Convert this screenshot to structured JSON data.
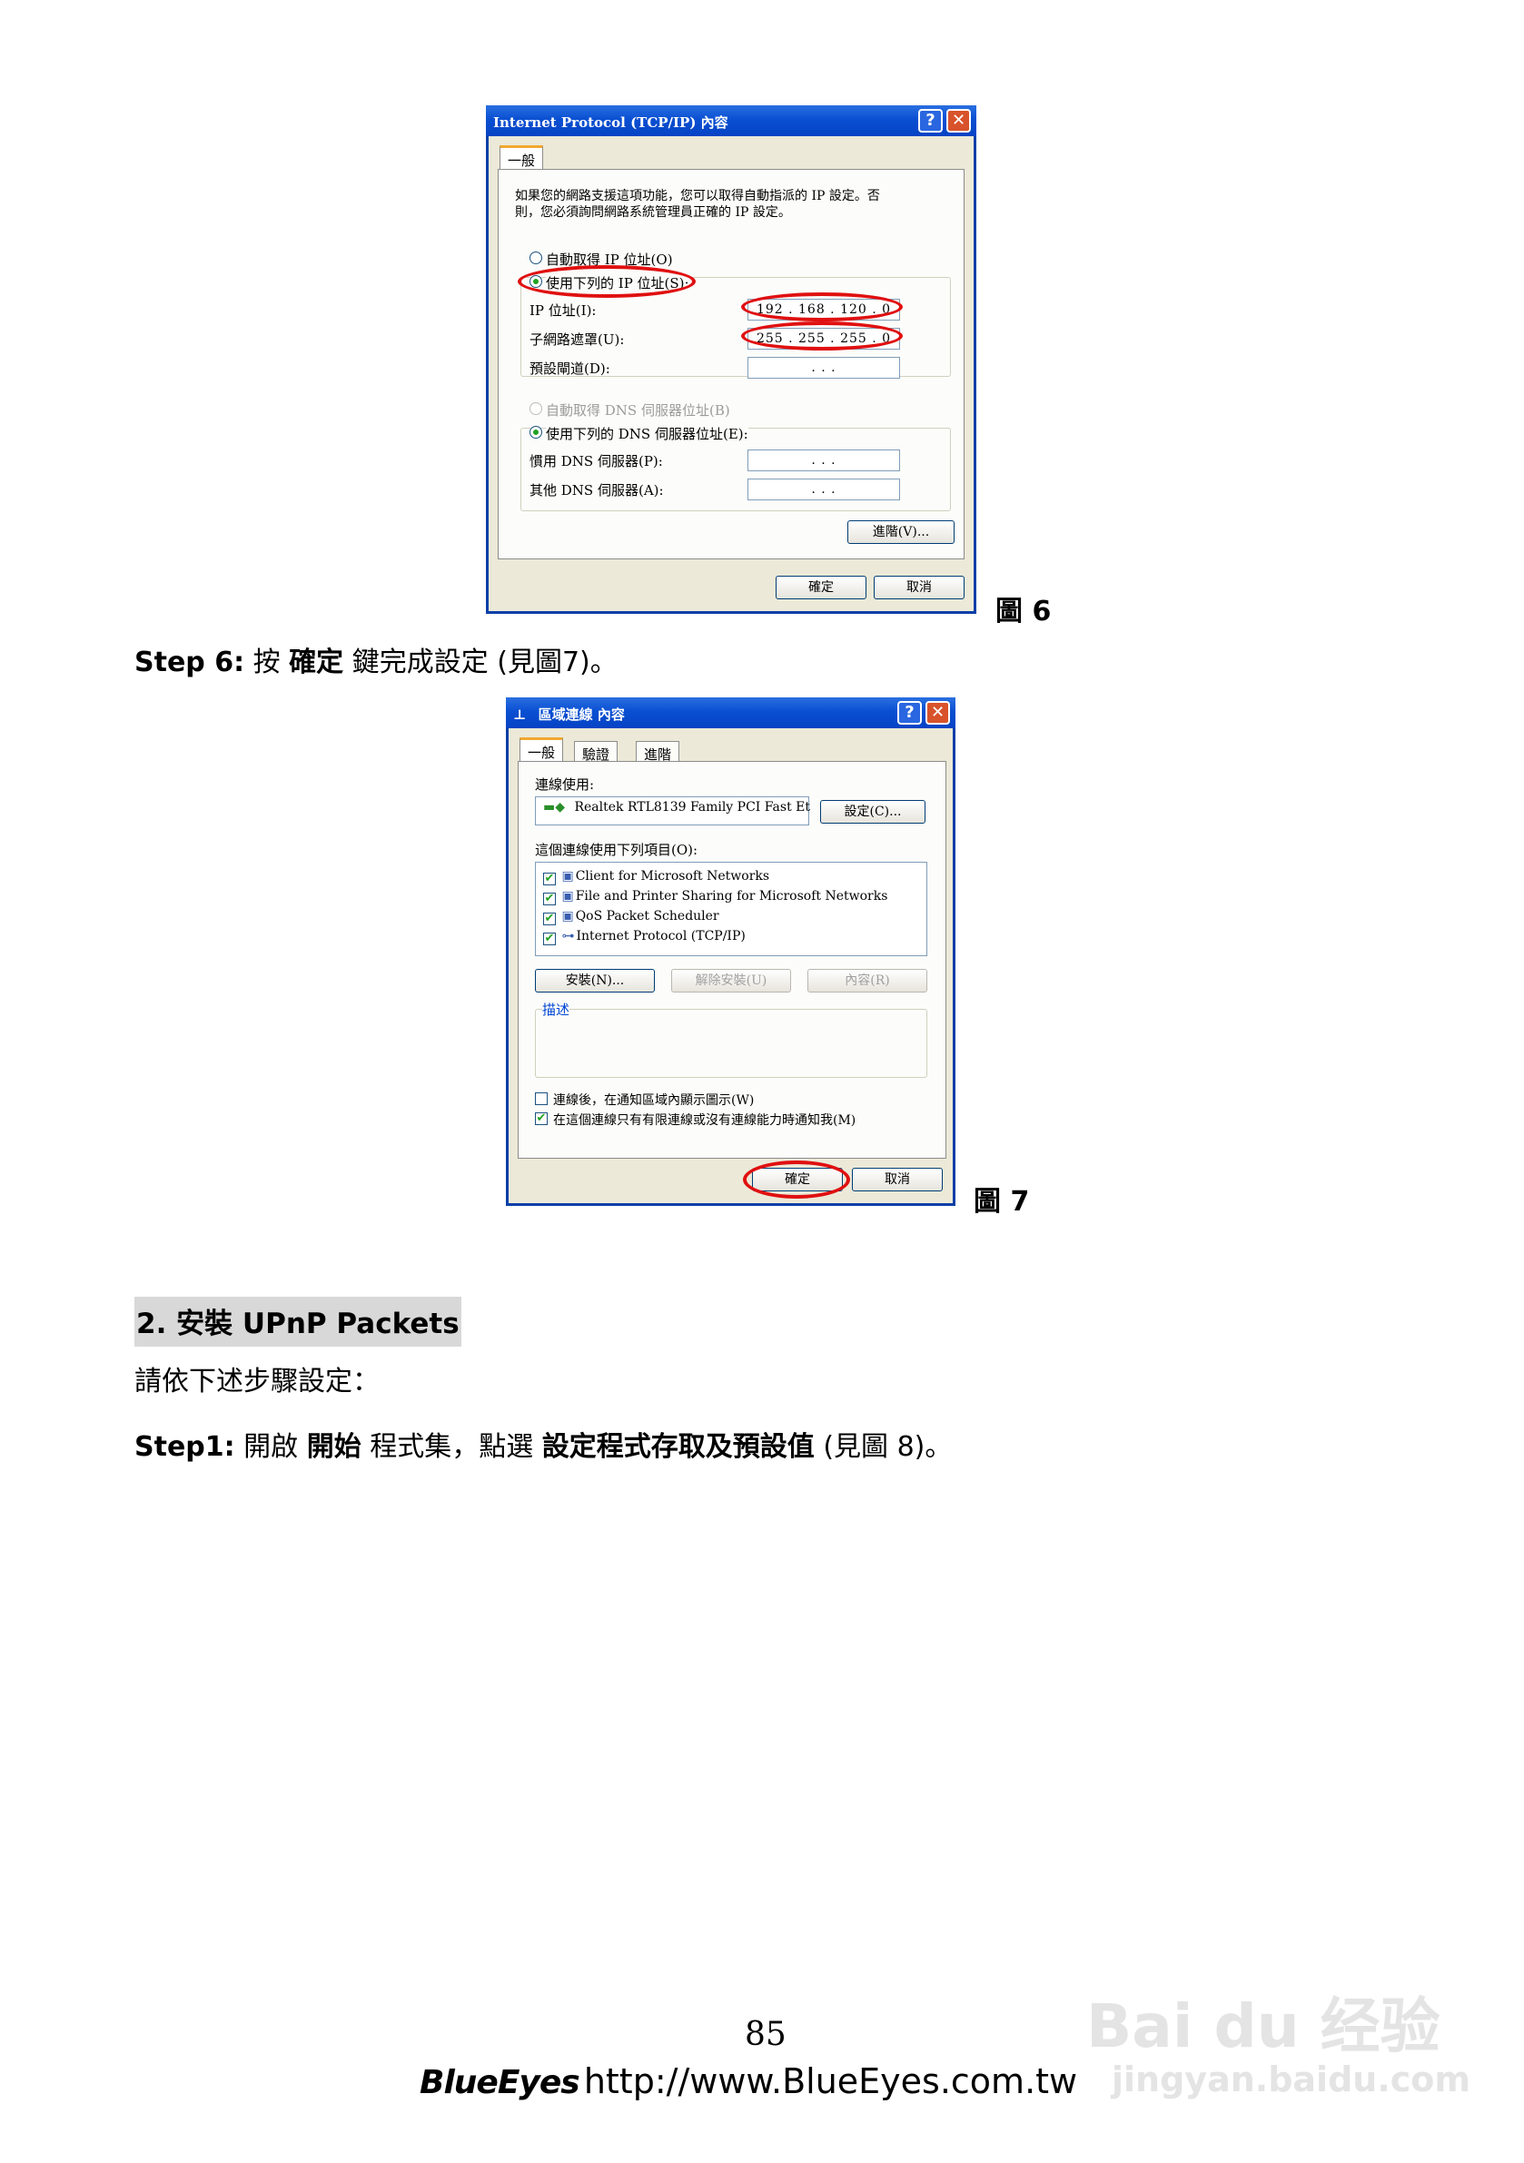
{
  "figure6": {
    "title": "Internet Protocol (TCP/IP) 內容",
    "tab_general": "一般",
    "description": "如果您的網路支援這項功能，您可以取得自動指派的 IP 設定。否",
    "description2": "則，您必須詢問網路系統管理員正確的 IP 設定。",
    "radio_auto_ip": "自動取得 IP 位址(O)",
    "radio_manual_ip": "使用下列的 IP 位址(S):",
    "ip_label": "IP 位址(I):",
    "ip_value": "192 . 168 . 120 .   0",
    "mask_label": "子網路遮罩(U):",
    "mask_value": "255 . 255 . 255 .   0",
    "gateway_label": "預設閘道(D):",
    "gateway_value": ".       .       .",
    "radio_auto_dns": "自動取得 DNS 伺服器位址(B)",
    "radio_manual_dns": "使用下列的 DNS 伺服器位址(E):",
    "dns1_label": "慣用 DNS 伺服器(P):",
    "dns1_value": ".       .       .",
    "dns2_label": "其他 DNS 伺服器(A):",
    "dns2_value": ".       .       .",
    "advanced_button": "進階(V)...",
    "ok_button": "確定",
    "cancel_button": "取消",
    "caption": "圖 6"
  },
  "step6": {
    "prefix": "Step 6:",
    "text1": " 按 ",
    "bold": "確定",
    "text2": " 鍵完成設定 (見圖7)。"
  },
  "figure7": {
    "title": "區域連線 內容",
    "tabs": [
      "一般",
      "驗證",
      "進階"
    ],
    "connect_using_label": "連線使用:",
    "adapter_name": "Realtek RTL8139 Family PCI Fast Et",
    "configure_button": "設定(C)...",
    "items_label": "這個連線使用下列項目(O):",
    "items": [
      "Client for Microsoft Networks",
      "File and Printer Sharing for Microsoft Networks",
      "QoS Packet Scheduler",
      "Internet Protocol (TCP/IP)"
    ],
    "install_button": "安裝(N)...",
    "uninstall_button": "解除安裝(U)",
    "properties_button": "內容(R)",
    "description_label": "描述",
    "check_show_icon": "連線後，在通知區域內顯示圖示(W)",
    "check_notify": "在這個連線只有有限連線或沒有連線能力時通知我(M)",
    "ok_button": "確定",
    "cancel_button": "取消",
    "caption": "圖 7"
  },
  "section2": {
    "heading": "2. 安裝 UPnP Packets",
    "intro": "請依下述步驟設定：",
    "step1_prefix": "Step1:",
    "step1_text1": " 開啟 ",
    "step1_bold1": "開始",
    "step1_text2": " 程式集，點選 ",
    "step1_bold2": "設定程式存取及預設值",
    "step1_text3": " (見圖 8)。"
  },
  "footer": {
    "page_number": "85",
    "brand": "BlueEyes",
    "url": "http://www.BlueEyes.com.tw"
  },
  "watermark": {
    "logo": "Bai du 经验",
    "url": "jingyan.baidu.com"
  }
}
